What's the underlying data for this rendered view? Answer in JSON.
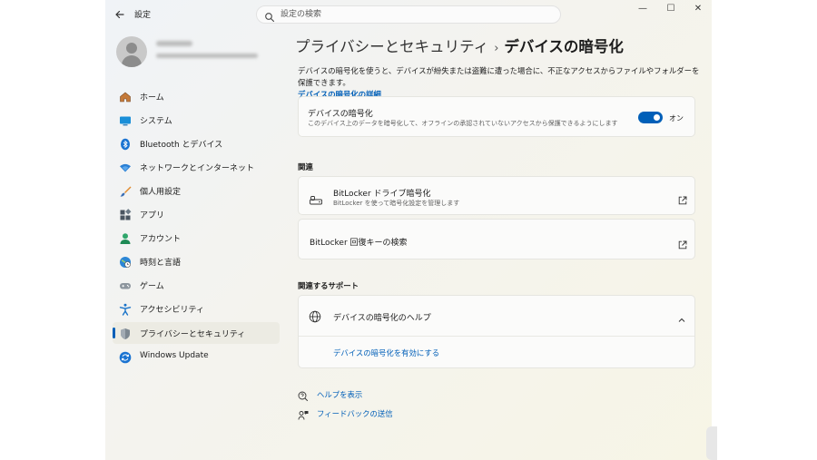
{
  "app": {
    "title": "設定"
  },
  "search": {
    "placeholder": "設定の検索"
  },
  "window_controls": {
    "minimize": "—",
    "maximize": "☐",
    "close": "✕"
  },
  "sidebar": {
    "items": [
      {
        "label": "ホーム",
        "icon": "home-icon"
      },
      {
        "label": "システム",
        "icon": "system-icon"
      },
      {
        "label": "Bluetooth とデバイス",
        "icon": "bluetooth-icon"
      },
      {
        "label": "ネットワークとインターネット",
        "icon": "wifi-icon"
      },
      {
        "label": "個人用設定",
        "icon": "brush-icon"
      },
      {
        "label": "アプリ",
        "icon": "apps-icon"
      },
      {
        "label": "アカウント",
        "icon": "account-icon"
      },
      {
        "label": "時刻と言語",
        "icon": "globe-clock-icon"
      },
      {
        "label": "ゲーム",
        "icon": "gamepad-icon"
      },
      {
        "label": "アクセシビリティ",
        "icon": "accessibility-icon"
      },
      {
        "label": "プライバシーとセキュリティ",
        "icon": "shield-icon",
        "active": true
      },
      {
        "label": "Windows Update",
        "icon": "update-icon"
      }
    ]
  },
  "breadcrumb": {
    "parent": "プライバシーとセキュリティ",
    "separator": "›",
    "current": "デバイスの暗号化"
  },
  "description": {
    "text": "デバイスの暗号化を使うと、デバイスが紛失または盗難に遭った場合に、不正なアクセスからファイルやフォルダーを保護できます。",
    "link": "デバイスの暗号化の詳細"
  },
  "encryption_card": {
    "title": "デバイスの暗号化",
    "subtitle": "このデバイス上のデータを暗号化して、オフラインの承認されていないアクセスから保護できるようにします",
    "toggle_label": "オン",
    "toggle_on": true,
    "accent": "#005fb8"
  },
  "related": {
    "heading": "関連",
    "bitlocker": {
      "title": "BitLocker ドライブ暗号化",
      "subtitle": "BitLocker を使って暗号化設定を管理します"
    },
    "recovery": {
      "title": "BitLocker 回復キーの検索"
    }
  },
  "support": {
    "heading": "関連するサポート",
    "help_title": "デバイスの暗号化のヘルプ",
    "help_link": "デバイスの暗号化を有効にする"
  },
  "footer": {
    "get_help": "ヘルプを表示",
    "feedback": "フィードバックの送信"
  }
}
